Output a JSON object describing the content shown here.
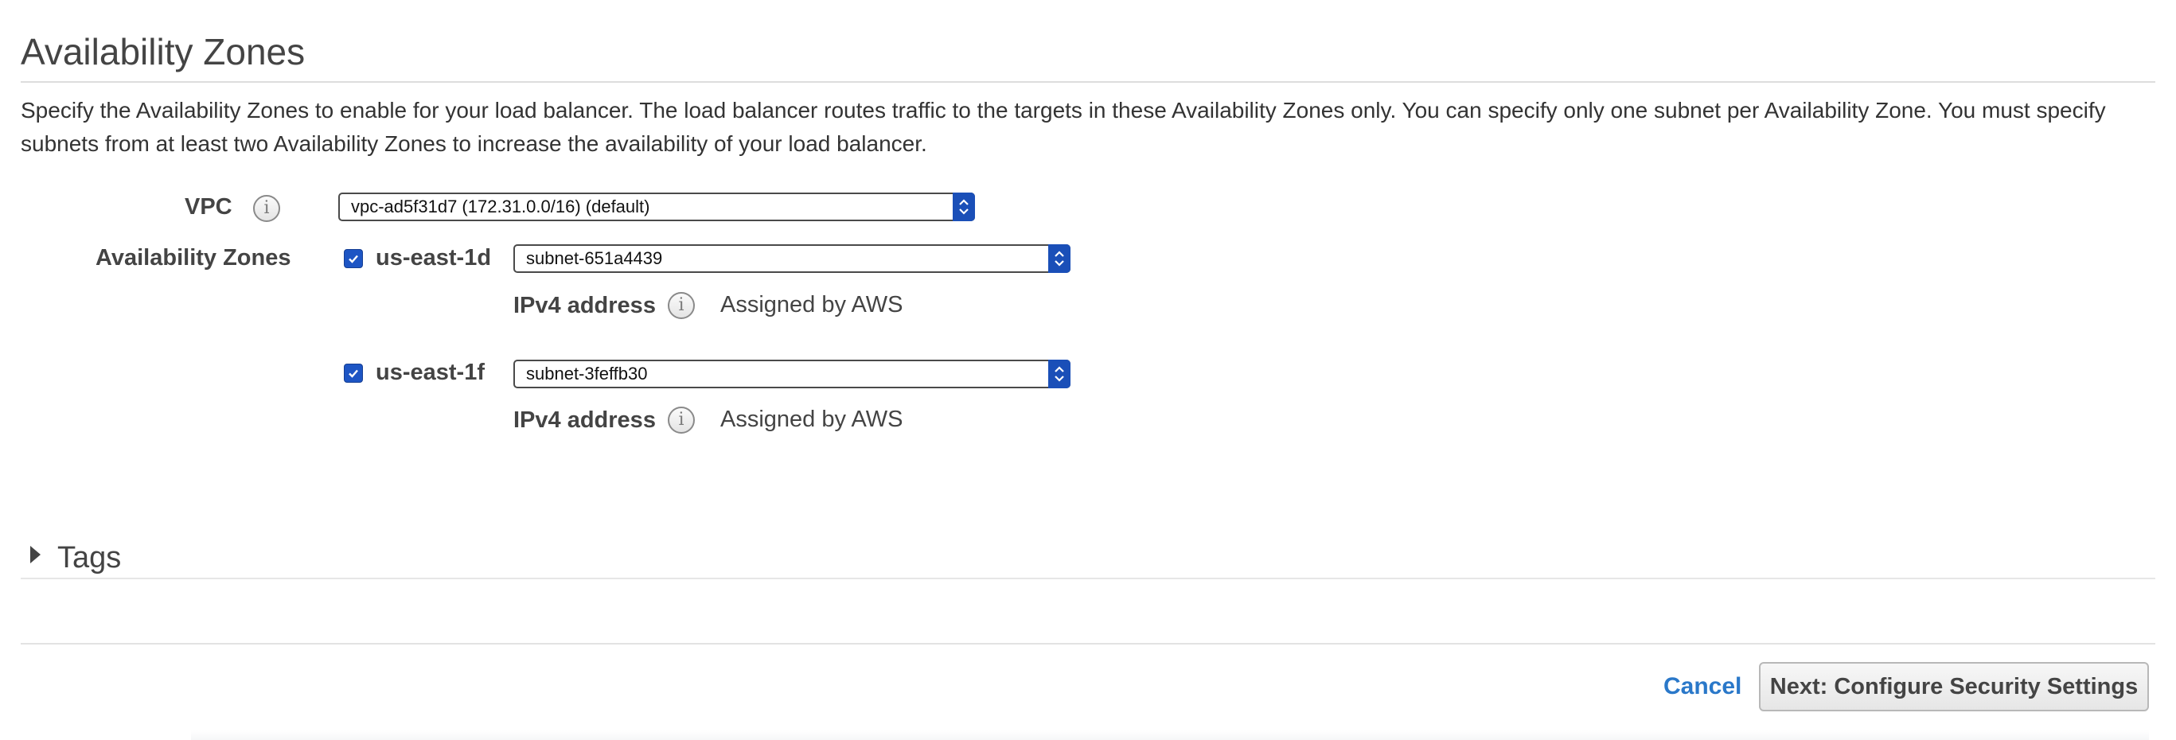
{
  "section": {
    "title": "Availability Zones",
    "description": "Specify the Availability Zones to enable for your load balancer. The load balancer routes traffic to the targets in these Availability Zones only. You can specify only one subnet per Availability Zone. You must specify subnets from at least two Availability Zones to increase the availability of your load balancer."
  },
  "vpc": {
    "label": "VPC",
    "selected": "vpc-ad5f31d7 (172.31.0.0/16) (default)",
    "info_icon": "info-icon"
  },
  "availability_zones": {
    "label": "Availability Zones",
    "zones": [
      {
        "name": "us-east-1d",
        "checked": true,
        "subnet": "subnet-651a4439",
        "ipv4_label": "IPv4 address",
        "ipv4_value": "Assigned by AWS"
      },
      {
        "name": "us-east-1f",
        "checked": true,
        "subnet": "subnet-3feffb30",
        "ipv4_label": "IPv4 address",
        "ipv4_value": "Assigned by AWS"
      }
    ]
  },
  "tags": {
    "label": "Tags",
    "toggle_icon": "caret-right-icon"
  },
  "footer": {
    "cancel_label": "Cancel",
    "next_label": "Next: Configure Security Settings"
  },
  "colors": {
    "accent_select": "#1a4fb8",
    "checkbox": "#1d55c4",
    "link": "#2a78c9"
  }
}
